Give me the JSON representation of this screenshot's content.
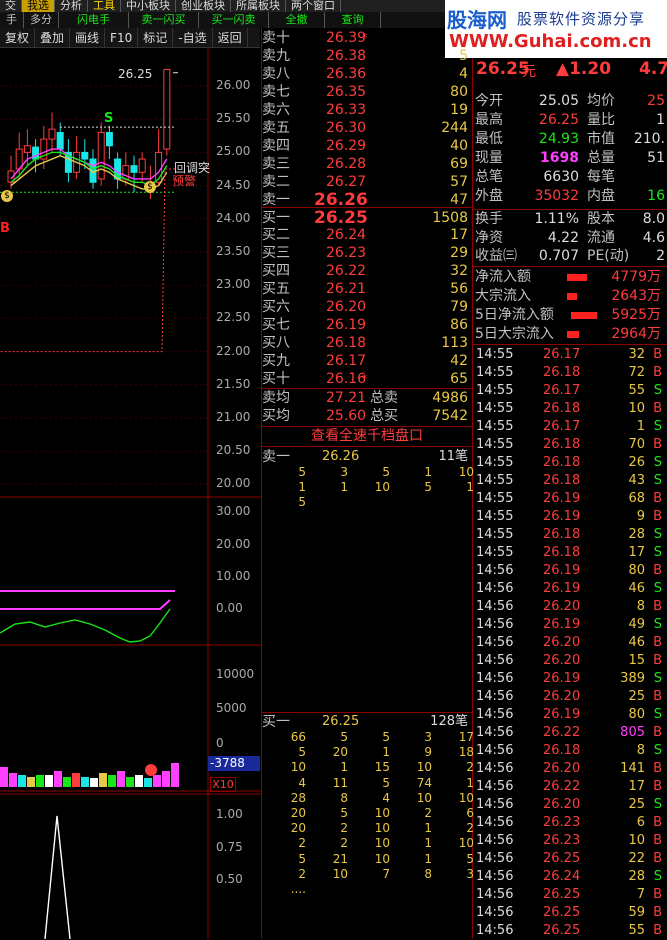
{
  "menu_row1": [
    "交",
    "我选",
    "分析",
    "工具",
    "中小板块",
    "创业板块",
    "所属板块",
    "两个窗口"
  ],
  "menu_row2": [
    "手",
    "多分",
    "闪电手",
    "卖一闪买",
    "买一闪卖",
    "全撤",
    "查询"
  ],
  "toolbar": [
    "复权",
    "叠加",
    "画线",
    "F10",
    "标记",
    "-自选",
    "返回"
  ],
  "logo": {
    "brand": "股海网",
    "tagline": "股票软件资源分享",
    "url": "WWW.Guhai.com.cn"
  },
  "chart": {
    "price_axis": [
      "26.00",
      "25.50",
      "25.00",
      "24.50",
      "24.00",
      "23.50",
      "23.00",
      "22.50",
      "22.00",
      "21.50",
      "21.00",
      "20.50",
      "20.00"
    ],
    "high_label": "26.25",
    "indicator_axis": [
      "30.00",
      "20.00",
      "10.00",
      "0.00"
    ],
    "volume_axis": [
      "10000",
      "5000",
      "0"
    ],
    "volume_readout": "-3788",
    "zoom": "X10",
    "bottom_axis": [
      "1.00",
      "0.75",
      "0.50"
    ],
    "signals": {
      "s": "S",
      "b": "B",
      "ma_label": "回调突",
      "warn": "预警",
      "dollar": "$"
    }
  },
  "orderbook": {
    "sells": [
      {
        "l": "卖十",
        "p": "26.39",
        "v": "",
        "m": "*"
      },
      {
        "l": "卖九",
        "p": "26.38",
        "v": "5"
      },
      {
        "l": "卖八",
        "p": "26.36",
        "v": "4"
      },
      {
        "l": "卖七",
        "p": "26.35",
        "v": "80"
      },
      {
        "l": "卖六",
        "p": "26.33",
        "v": "19"
      },
      {
        "l": "卖五",
        "p": "26.30",
        "v": "244"
      },
      {
        "l": "卖四",
        "p": "26.29",
        "v": "40"
      },
      {
        "l": "卖三",
        "p": "26.28",
        "v": "69"
      },
      {
        "l": "卖二",
        "p": "26.27",
        "v": "57"
      },
      {
        "l": "卖一",
        "p": "26.26",
        "v": "47"
      }
    ],
    "buys": [
      {
        "l": "买一",
        "p": "26.25",
        "v": "1508"
      },
      {
        "l": "买二",
        "p": "26.24",
        "v": "17"
      },
      {
        "l": "买三",
        "p": "26.23",
        "v": "29"
      },
      {
        "l": "买四",
        "p": "26.22",
        "v": "32"
      },
      {
        "l": "买五",
        "p": "26.21",
        "v": "56"
      },
      {
        "l": "买六",
        "p": "26.20",
        "v": "79"
      },
      {
        "l": "买七",
        "p": "26.19",
        "v": "86"
      },
      {
        "l": "买八",
        "p": "26.18",
        "v": "113"
      },
      {
        "l": "买九",
        "p": "26.17",
        "v": "42"
      },
      {
        "l": "买十",
        "p": "26.16",
        "v": "65",
        "m": "*"
      }
    ],
    "avg_sell": {
      "l": "卖均",
      "p": "27.21",
      "l2": "总卖",
      "v": "4986"
    },
    "avg_buy": {
      "l": "买均",
      "p": "25.60",
      "l2": "总买",
      "v": "7542"
    },
    "link": "查看全速千档盘口",
    "sell_queue": {
      "l": "卖一",
      "p": "26.26",
      "n": "11笔",
      "rows": [
        [
          "5",
          "3",
          "5",
          "1",
          "10"
        ],
        [
          "1",
          "1",
          "10",
          "5",
          "1"
        ],
        [
          "5",
          "",
          "",
          "",
          ""
        ]
      ]
    },
    "buy_queue": {
      "l": "买一",
      "p": "26.25",
      "n": "128笔",
      "rows": [
        [
          "66",
          "5",
          "5",
          "3",
          "17"
        ],
        [
          "5",
          "20",
          "1",
          "9",
          "18"
        ],
        [
          "10",
          "1",
          "15",
          "10",
          "2"
        ],
        [
          "4",
          "11",
          "5",
          "74",
          "1"
        ],
        [
          "28",
          "8",
          "4",
          "10",
          "10"
        ],
        [
          "20",
          "5",
          "10",
          "2",
          "6"
        ],
        [
          "20",
          "2",
          "10",
          "1",
          "2"
        ],
        [
          "2",
          "2",
          "10",
          "1",
          "10"
        ],
        [
          "5",
          "21",
          "10",
          "1",
          "5"
        ],
        [
          "2",
          "10",
          "7",
          "8",
          "3"
        ],
        [
          "....",
          "",
          "",
          "",
          ""
        ]
      ]
    }
  },
  "quote": {
    "price": "26.25",
    "unit": "元",
    "change": "▲1.20",
    "pct": "4.7",
    "rows": [
      [
        "今开",
        "25.05",
        "均价",
        "25"
      ],
      [
        "最高",
        "26.25",
        "量比",
        "1"
      ],
      [
        "最低",
        "24.93",
        "市值",
        "210."
      ],
      [
        "现量",
        "1698",
        "总量",
        "51"
      ],
      [
        "总笔",
        "6630",
        "每笔",
        ""
      ],
      [
        "外盘",
        "35032",
        "内盘",
        "16"
      ],
      [
        "换手",
        "1.11%",
        "股本",
        "8.0"
      ],
      [
        "净资",
        "4.22",
        "流通",
        "4.6"
      ],
      [
        "收益㈢",
        "0.707",
        "PE(动)",
        "2"
      ]
    ],
    "flows": [
      [
        "净流入额",
        "4779万"
      ],
      [
        "大宗流入",
        "2643万"
      ],
      [
        "5日净流入额",
        "5925万"
      ],
      [
        "5日大宗流入",
        "2964万"
      ]
    ]
  },
  "ticks": [
    [
      "14:55",
      "26.17",
      "32",
      "B"
    ],
    [
      "14:55",
      "26.18",
      "72",
      "B"
    ],
    [
      "14:55",
      "26.17",
      "55",
      "S"
    ],
    [
      "14:55",
      "26.18",
      "10",
      "B"
    ],
    [
      "14:55",
      "26.17",
      "1",
      "S"
    ],
    [
      "14:55",
      "26.18",
      "70",
      "B"
    ],
    [
      "14:55",
      "26.18",
      "26",
      "S"
    ],
    [
      "14:55",
      "26.18",
      "43",
      "S"
    ],
    [
      "14:55",
      "26.19",
      "68",
      "B"
    ],
    [
      "14:55",
      "26.19",
      "9",
      "B"
    ],
    [
      "14:55",
      "26.18",
      "28",
      "S"
    ],
    [
      "14:55",
      "26.18",
      "17",
      "S"
    ],
    [
      "14:56",
      "26.19",
      "80",
      "B"
    ],
    [
      "14:56",
      "26.19",
      "46",
      "S"
    ],
    [
      "14:56",
      "26.20",
      "8",
      "B"
    ],
    [
      "14:56",
      "26.19",
      "49",
      "S"
    ],
    [
      "14:56",
      "26.20",
      "46",
      "B"
    ],
    [
      "14:56",
      "26.20",
      "15",
      "B"
    ],
    [
      "14:56",
      "26.19",
      "389",
      "S"
    ],
    [
      "14:56",
      "26.20",
      "25",
      "B"
    ],
    [
      "14:56",
      "26.19",
      "80",
      "S"
    ],
    [
      "14:56",
      "26.22",
      "805",
      "B"
    ],
    [
      "14:56",
      "26.18",
      "8",
      "S"
    ],
    [
      "14:56",
      "26.20",
      "141",
      "B"
    ],
    [
      "14:56",
      "26.22",
      "17",
      "B"
    ],
    [
      "14:56",
      "26.20",
      "25",
      "S"
    ],
    [
      "14:56",
      "26.23",
      "6",
      "B"
    ],
    [
      "14:56",
      "26.23",
      "10",
      "B"
    ],
    [
      "14:56",
      "26.25",
      "22",
      "B"
    ],
    [
      "14:56",
      "26.24",
      "28",
      "S"
    ],
    [
      "14:56",
      "26.25",
      "7",
      "B"
    ],
    [
      "14:56",
      "26.25",
      "59",
      "B"
    ],
    [
      "14:56",
      "26.25",
      "55",
      "B"
    ]
  ]
}
